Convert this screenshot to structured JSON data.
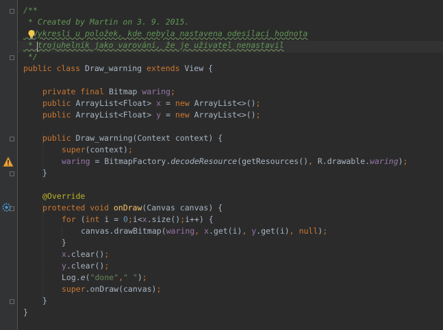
{
  "editor": {
    "colors": {
      "background": "#2b2b2b",
      "gutter": "#313335",
      "default_text": "#a9b7c6",
      "keyword": "#cc7832",
      "field": "#9876aa",
      "string": "#6a8759",
      "number": "#6897bb",
      "method_decl": "#ffc66d",
      "annotation": "#bbb529",
      "javadoc": "#629755"
    },
    "lines": [
      {
        "indent": 0,
        "tokens": [
          {
            "t": "/**",
            "c": "javadoc"
          }
        ]
      },
      {
        "indent": 0,
        "tokens": [
          {
            "t": " * Created by Martin on 3. 9. 2015.",
            "c": "javadoc"
          }
        ]
      },
      {
        "indent": 0,
        "tokens": [
          {
            "t": "  Vykresli u položek, kde nebyla nastavena odesílací hodnota",
            "c": "javadoc"
          }
        ]
      },
      {
        "indent": 0,
        "tokens": [
          {
            "t": " * trojuhelník jako varování, že je uživatel nenastavil",
            "c": "javadoc"
          }
        ]
      },
      {
        "indent": 0,
        "tokens": [
          {
            "t": " */",
            "c": "javadoc"
          }
        ]
      },
      {
        "indent": 0,
        "tokens": [
          {
            "t": "public class ",
            "c": "keyword"
          },
          {
            "t": "Draw_warning ",
            "c": "text"
          },
          {
            "t": "extends ",
            "c": "keyword"
          },
          {
            "t": "View {",
            "c": "text"
          }
        ]
      },
      {
        "indent": 0,
        "tokens": []
      },
      {
        "indent": 1,
        "tokens": [
          {
            "t": "private final ",
            "c": "keyword"
          },
          {
            "t": "Bitmap ",
            "c": "text"
          },
          {
            "t": "waring",
            "c": "field"
          },
          {
            "t": ";",
            "c": "keyword"
          }
        ]
      },
      {
        "indent": 1,
        "tokens": [
          {
            "t": "public ",
            "c": "keyword"
          },
          {
            "t": "ArrayList<Float> ",
            "c": "text"
          },
          {
            "t": "x ",
            "c": "field"
          },
          {
            "t": "= ",
            "c": "text"
          },
          {
            "t": "new ",
            "c": "keyword"
          },
          {
            "t": "ArrayList<>()",
            "c": "text"
          },
          {
            "t": ";",
            "c": "keyword"
          }
        ]
      },
      {
        "indent": 1,
        "tokens": [
          {
            "t": "public ",
            "c": "keyword"
          },
          {
            "t": "ArrayList<Float> ",
            "c": "text"
          },
          {
            "t": "y ",
            "c": "field"
          },
          {
            "t": "= ",
            "c": "text"
          },
          {
            "t": "new ",
            "c": "keyword"
          },
          {
            "t": "ArrayList<>()",
            "c": "text"
          },
          {
            "t": ";",
            "c": "keyword"
          }
        ]
      },
      {
        "indent": 0,
        "tokens": []
      },
      {
        "indent": 1,
        "tokens": [
          {
            "t": "public ",
            "c": "keyword"
          },
          {
            "t": "Draw_warning(Context context) {",
            "c": "text"
          }
        ]
      },
      {
        "indent": 2,
        "tokens": [
          {
            "t": "super",
            "c": "keyword"
          },
          {
            "t": "(context)",
            "c": "text"
          },
          {
            "t": ";",
            "c": "keyword"
          }
        ]
      },
      {
        "indent": 2,
        "tokens": [
          {
            "t": "waring ",
            "c": "field"
          },
          {
            "t": "= BitmapFactory.",
            "c": "text"
          },
          {
            "t": "decodeResource",
            "c": "italic"
          },
          {
            "t": "(getResources()",
            "c": "text"
          },
          {
            "t": ", ",
            "c": "keyword"
          },
          {
            "t": "R.drawable.",
            "c": "text"
          },
          {
            "t": "waring",
            "c": "field_italic"
          },
          {
            "t": ")",
            "c": "text"
          },
          {
            "t": ";",
            "c": "keyword"
          }
        ]
      },
      {
        "indent": 1,
        "tokens": [
          {
            "t": "}",
            "c": "text"
          }
        ]
      },
      {
        "indent": 0,
        "tokens": []
      },
      {
        "indent": 1,
        "tokens": [
          {
            "t": "@Override",
            "c": "annotation"
          }
        ]
      },
      {
        "indent": 1,
        "tokens": [
          {
            "t": "protected void ",
            "c": "keyword"
          },
          {
            "t": "onDraw",
            "c": "method_decl"
          },
          {
            "t": "(Canvas canvas) {",
            "c": "text"
          }
        ]
      },
      {
        "indent": 2,
        "tokens": [
          {
            "t": "for ",
            "c": "keyword"
          },
          {
            "t": "(",
            "c": "text"
          },
          {
            "t": "int ",
            "c": "keyword"
          },
          {
            "t": "i = ",
            "c": "text"
          },
          {
            "t": "0",
            "c": "number"
          },
          {
            "t": ";",
            "c": "keyword"
          },
          {
            "t": "i<",
            "c": "text"
          },
          {
            "t": "x",
            "c": "field"
          },
          {
            "t": ".size()",
            "c": "text"
          },
          {
            "t": ";",
            "c": "keyword"
          },
          {
            "t": "i++) {",
            "c": "text"
          }
        ]
      },
      {
        "indent": 3,
        "tokens": [
          {
            "t": "canvas.drawBitmap(",
            "c": "text"
          },
          {
            "t": "waring",
            "c": "field"
          },
          {
            "t": ", ",
            "c": "keyword"
          },
          {
            "t": "x",
            "c": "field"
          },
          {
            "t": ".get(i)",
            "c": "text"
          },
          {
            "t": ", ",
            "c": "keyword"
          },
          {
            "t": "y",
            "c": "field"
          },
          {
            "t": ".get(i)",
            "c": "text"
          },
          {
            "t": ", ",
            "c": "keyword"
          },
          {
            "t": "null",
            "c": "keyword"
          },
          {
            "t": ")",
            "c": "text"
          },
          {
            "t": ";",
            "c": "keyword"
          }
        ]
      },
      {
        "indent": 2,
        "tokens": [
          {
            "t": "}",
            "c": "text"
          }
        ]
      },
      {
        "indent": 2,
        "tokens": [
          {
            "t": "x",
            "c": "field"
          },
          {
            "t": ".clear()",
            "c": "text"
          },
          {
            "t": ";",
            "c": "keyword"
          }
        ]
      },
      {
        "indent": 2,
        "tokens": [
          {
            "t": "y",
            "c": "field"
          },
          {
            "t": ".clear()",
            "c": "text"
          },
          {
            "t": ";",
            "c": "keyword"
          }
        ]
      },
      {
        "indent": 2,
        "tokens": [
          {
            "t": "Log.",
            "c": "text"
          },
          {
            "t": "e",
            "c": "italic"
          },
          {
            "t": "(",
            "c": "text"
          },
          {
            "t": "\"done\"",
            "c": "string"
          },
          {
            "t": ",",
            "c": "keyword"
          },
          {
            "t": "\" \"",
            "c": "string"
          },
          {
            "t": ")",
            "c": "text"
          },
          {
            "t": ";",
            "c": "keyword"
          }
        ]
      },
      {
        "indent": 2,
        "tokens": [
          {
            "t": "super",
            "c": "keyword"
          },
          {
            "t": ".onDraw(canvas)",
            "c": "text"
          },
          {
            "t": ";",
            "c": "keyword"
          }
        ]
      },
      {
        "indent": 1,
        "tokens": [
          {
            "t": "}",
            "c": "text"
          }
        ]
      },
      {
        "indent": 0,
        "tokens": [
          {
            "t": "}",
            "c": "text"
          }
        ]
      }
    ],
    "gutter_markers": [
      {
        "line": 13,
        "icon": "warning-triangle-icon"
      },
      {
        "line": 17,
        "icon": "override-method-icon"
      }
    ],
    "inline_markers": [
      {
        "line": 2,
        "icon": "lightbulb-icon"
      }
    ]
  }
}
